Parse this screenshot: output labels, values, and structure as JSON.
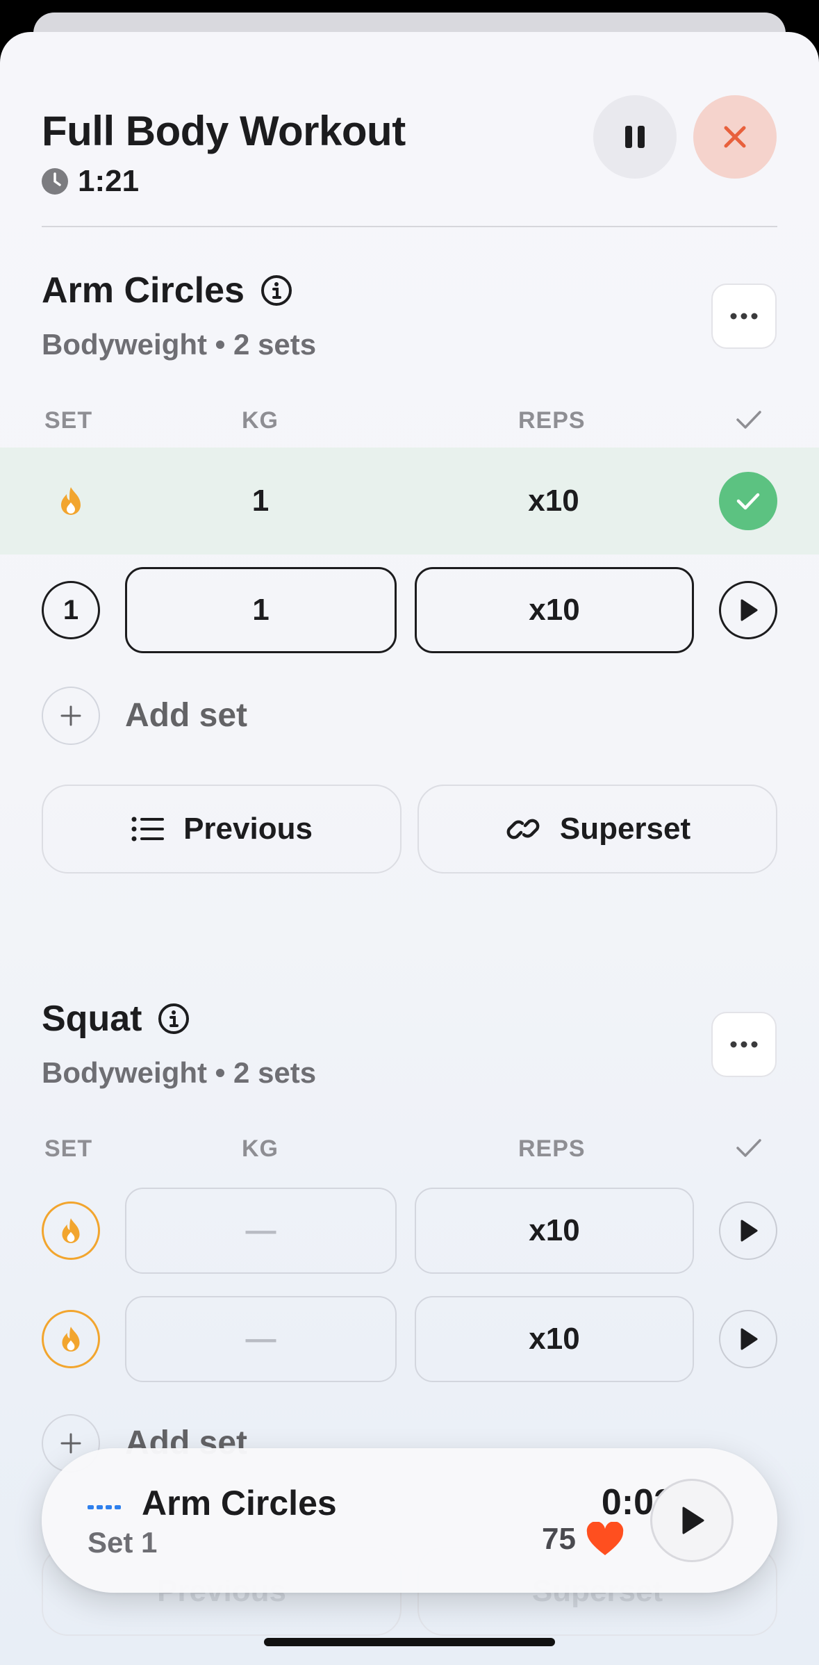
{
  "workout": {
    "title": "Full Body Workout",
    "elapsed": "1:21"
  },
  "exercises": [
    {
      "name": "Arm Circles",
      "subtitle": "Bodyweight • 2 sets",
      "columns": {
        "set": "SET",
        "kg": "KG",
        "reps": "REPS"
      },
      "sets": [
        {
          "type": "warmup",
          "kg": "1",
          "reps": "x10",
          "completed": true
        },
        {
          "type": "normal",
          "number": "1",
          "kg": "1",
          "reps": "x10",
          "completed": false
        }
      ],
      "add_set_label": "Add set",
      "previous_label": "Previous",
      "superset_label": "Superset"
    },
    {
      "name": "Squat",
      "subtitle": "Bodyweight • 2 sets",
      "columns": {
        "set": "SET",
        "kg": "KG",
        "reps": "REPS"
      },
      "sets": [
        {
          "type": "warmup",
          "kg": "—",
          "reps": "x10",
          "completed": false
        },
        {
          "type": "warmup",
          "kg": "—",
          "reps": "x10",
          "completed": false
        }
      ],
      "add_set_label": "Add set",
      "previous_label": "Previous",
      "superset_label": "Superset"
    }
  ],
  "mini_player": {
    "exercise": "Arm Circles",
    "set_label": "Set 1",
    "time": "0:02",
    "heart_rate": "75"
  },
  "colors": {
    "accent_done": "#5cc281",
    "warmup": "#f2a52e",
    "close": "#e8603c",
    "heart": "#ff4f1f",
    "dash": "#2f80ed"
  },
  "icons": [
    "clock-icon",
    "pause-icon",
    "close-icon",
    "info-icon",
    "ellipsis-icon",
    "flame-icon",
    "checkmark-icon",
    "play-icon",
    "plus-icon",
    "list-icon",
    "link-icon",
    "heart-icon"
  ]
}
